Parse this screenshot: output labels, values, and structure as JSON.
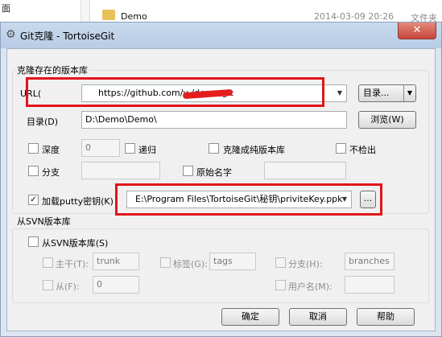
{
  "background": {
    "left_text": "面",
    "folder_name": "Demo",
    "folder_date": "2014-03-09 20:26",
    "folder_type": "文件夹"
  },
  "window": {
    "title": "Git克隆 - TortoiseGit",
    "close_label": "✕"
  },
  "clone_group": {
    "label": "克隆存在的版本库",
    "url_label": "URL(",
    "url_value": "https://github.com/y         /demo.git",
    "dir_button": "目录...",
    "target_label": "目录(D)",
    "target_value": "D:\\Demo\\Demo\\",
    "browse_button": "浏览(W)",
    "depth_label": "深度",
    "depth_value": "0",
    "recursive_label": "递归",
    "bare_label": "克隆成纯版本库",
    "no_checkout_label": "不检出",
    "branch_label": "分支",
    "origin_label": "原始名字"
  },
  "putty": {
    "label": "加载putty密钥(K)",
    "checked": true,
    "key_path": "E:\\Program Files\\TortoiseGit\\秘钥\\priviteKey.ppk",
    "browse_label": "..."
  },
  "svn_group": {
    "label": "从SVN版本库",
    "from_svn_label": "从SVN版本库(S)",
    "trunk_label": "主干(T):",
    "trunk_value": "trunk",
    "tags_label": "标签(G):",
    "tags_value": "tags",
    "branches_label": "分支(H):",
    "branches_value": "branches",
    "from_label": "从(F):",
    "from_value": "0",
    "username_label": "用户名(M):",
    "username_value": ""
  },
  "buttons": {
    "ok": "确定",
    "cancel": "取消",
    "help": "帮助"
  },
  "colors": {
    "highlight_box": "#e0151b",
    "title_bar": "#c9daee",
    "close_button": "#c7463a"
  }
}
